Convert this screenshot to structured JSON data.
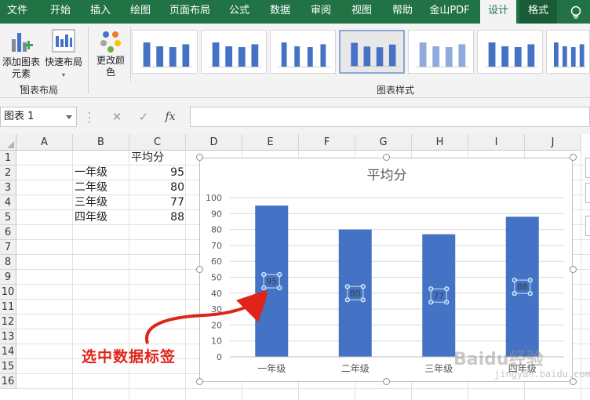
{
  "ribbon_tabs": [
    "文件",
    "开始",
    "插入",
    "绘图",
    "页面布局",
    "公式",
    "数据",
    "审阅",
    "视图",
    "帮助",
    "金山PDF",
    "设计",
    "格式"
  ],
  "active_tab": "设计",
  "ribbon": {
    "add_chart_element": "添加图表元素",
    "quick_layout": "快速布局",
    "change_colors": "更改颜色",
    "group_chart_layout": "图表布局",
    "group_chart_styles": "图表样式"
  },
  "formula_bar": {
    "name_box": "图表 1",
    "cancel_icon": "close-icon",
    "enter_icon": "check-icon",
    "fx_label": "fx",
    "formula": ""
  },
  "columns": [
    "A",
    "B",
    "C",
    "D",
    "E",
    "F",
    "G",
    "H",
    "I",
    "J"
  ],
  "rows": [
    "1",
    "2",
    "3",
    "4",
    "5",
    "6",
    "7",
    "8",
    "9",
    "10",
    "11",
    "12",
    "13",
    "14",
    "15",
    "16"
  ],
  "cells": {
    "C1": "平均分",
    "B2": "一年级",
    "C2": "95",
    "B3": "二年级",
    "C3": "80",
    "B4": "三年级",
    "C4": "77",
    "B5": "四年级",
    "C5": "88"
  },
  "chart_data": {
    "type": "bar",
    "title": "平均分",
    "categories": [
      "一年级",
      "二年级",
      "三年级",
      "四年级"
    ],
    "series": [
      {
        "values": [
          95,
          80,
          77,
          88
        ]
      }
    ],
    "ylim": [
      0,
      100
    ],
    "yticks": [
      0,
      10,
      20,
      30,
      40,
      50,
      60,
      70,
      80,
      90,
      100
    ],
    "grid": true,
    "bar_color": "#4472c4",
    "data_labels": [
      "95",
      "80",
      "77",
      "88"
    ],
    "data_labels_selected": true
  },
  "annotation": "选中数据标签",
  "watermark": "Baidu经验",
  "watermark_url": "jingyan.baidu.com",
  "colors": {
    "excel_green": "#217346",
    "bar_blue": "#4472c4",
    "annotation_red": "#e0241c"
  }
}
